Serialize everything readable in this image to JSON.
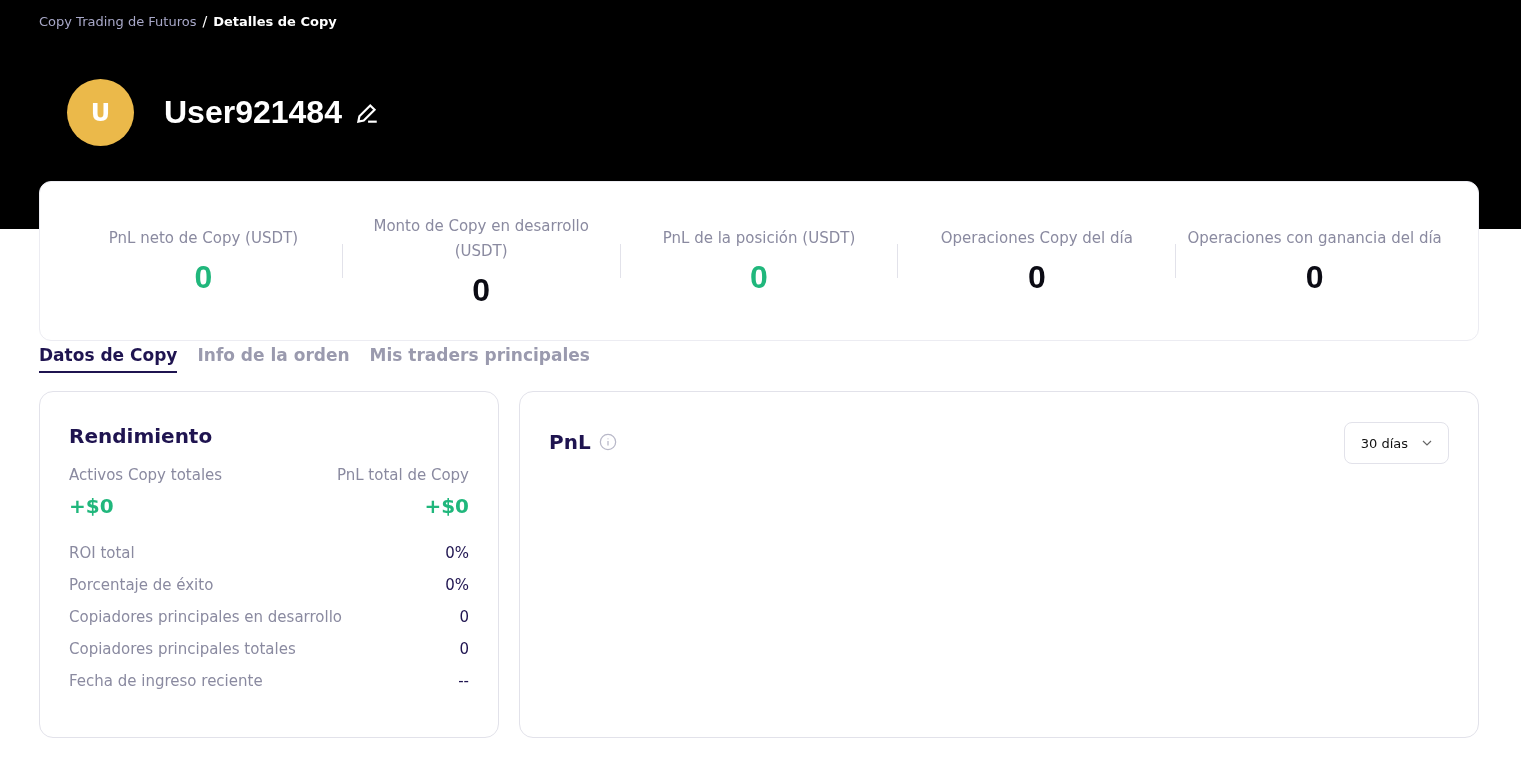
{
  "breadcrumb": [
    {
      "label": "Copy Trading de Futuros",
      "current": false
    },
    {
      "label": "Detalles de Copy",
      "current": true
    }
  ],
  "breadcrumb_separator": "/",
  "profile": {
    "avatar_letter": "U",
    "username": "User921484"
  },
  "stats": [
    {
      "label": "PnL neto de Copy (USDT)",
      "value": "0",
      "color": "#20b77c"
    },
    {
      "label": "Monto de Copy en desarrollo (USDT)",
      "value": "0",
      "color": "#0b0b14"
    },
    {
      "label": "PnL de la posición (USDT)",
      "value": "0",
      "color": "#20b77c"
    },
    {
      "label": "Operaciones Copy del día",
      "value": "0",
      "color": "#0b0b14"
    },
    {
      "label": "Operaciones con ganancia del día",
      "value": "0",
      "color": "#0b0b14"
    }
  ],
  "tabs": [
    {
      "label": "Datos de Copy",
      "selected": true
    },
    {
      "label": "Info de la orden",
      "selected": false
    },
    {
      "label": "Mis traders principales",
      "selected": false
    }
  ],
  "performance": {
    "title": "Rendimiento",
    "summary": [
      {
        "label": "Activos Copy totales",
        "value": "+$0"
      },
      {
        "label": "PnL total de Copy",
        "value": "+$0"
      }
    ],
    "rows": [
      {
        "label": "ROI total",
        "value": "0%"
      },
      {
        "label": "Porcentaje de éxito",
        "value": "0%"
      },
      {
        "label": "Copiadores principales en desarrollo",
        "value": "0"
      },
      {
        "label": "Copiadores principales totales",
        "value": "0"
      },
      {
        "label": "Fecha de ingreso reciente",
        "value": "--"
      }
    ]
  },
  "pnl": {
    "title": "PnL",
    "period": "30 días"
  }
}
